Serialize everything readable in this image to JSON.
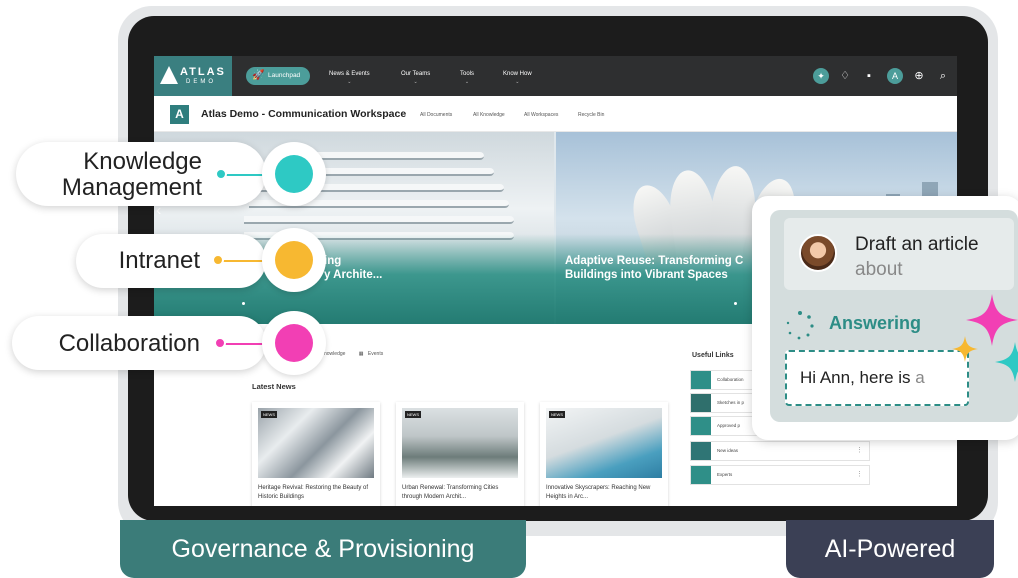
{
  "topnav": {
    "logo_text": "ATLAS",
    "logo_sub": "DEMO",
    "launchpad": "Launchpad",
    "items": [
      {
        "label": "News & Events"
      },
      {
        "label": "Our Teams"
      },
      {
        "label": "Tools"
      },
      {
        "label": "Know How"
      }
    ],
    "icons": [
      "atlas-assistant-icon",
      "bell-icon",
      "chat-icon",
      "copilot-icon",
      "add-circle-icon",
      "search-icon"
    ]
  },
  "site": {
    "letter": "A",
    "title": "Atlas Demo - Communication Workspace",
    "links": [
      "All Documents",
      "All Knowledge",
      "All Workspaces",
      "Recycle Bin"
    ]
  },
  "hero": {
    "left_caption_line1": "ing",
    "left_caption_line2": "y Archite...",
    "right_caption_line1": "Adaptive Reuse: Transforming C",
    "right_caption_line2": "Buildings into Vibrant Spaces"
  },
  "content": {
    "subtab_knowledge": "nowledge",
    "subtab_events": "Events",
    "latest_news": "Latest News",
    "news_tag": "NEWS",
    "news": [
      {
        "title": "Heritage Revival: Restoring the Beauty of Historic Buildings"
      },
      {
        "title": "Urban Renewal: Transforming Cities through Modern Archit..."
      },
      {
        "title": "Innovative Skyscrapers: Reaching New Heights in Arc..."
      }
    ],
    "useful_links_title": "Useful Links",
    "useful_links": [
      {
        "label": "Collaboration",
        "color": "#2f8f88"
      },
      {
        "label": "Sketches in p",
        "color": "#2f6f6c"
      },
      {
        "label": "Approved p",
        "color": "#2f8f88"
      },
      {
        "label": "New ideas",
        "color": "#2f7575"
      },
      {
        "label": "Experts",
        "color": "#2f8f88"
      }
    ]
  },
  "callouts": {
    "knowledge_line1": "Knowledge",
    "knowledge_line2": "Management",
    "intranet": "Intranet",
    "collaboration": "Collaboration",
    "colors": {
      "knowledge": "#2ec9c4",
      "intranet": "#f7b831",
      "collaboration": "#f23fb4"
    }
  },
  "ai": {
    "prompt_main": "Draft an article",
    "prompt_faded": "about",
    "status": "Answering",
    "reply_main": "Hi Ann, here is ",
    "reply_faded": "a"
  },
  "banners": {
    "left": "Governance & Provisioning",
    "right": "AI-Powered"
  }
}
